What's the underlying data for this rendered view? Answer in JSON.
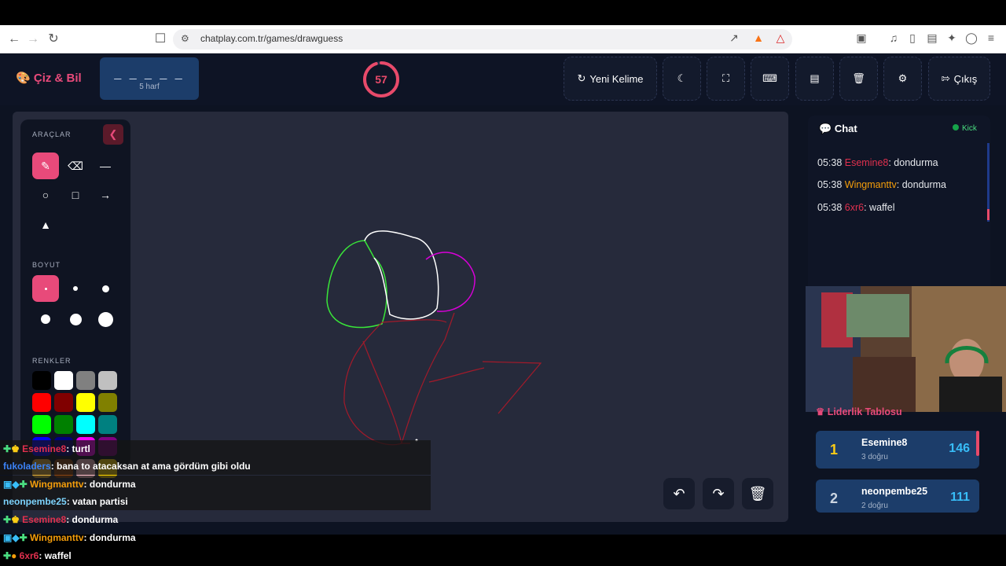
{
  "browser": {
    "url": "chatplay.com.tr/games/drawguess"
  },
  "header": {
    "logo": "Çiz & Bil",
    "word_dashes": "_ _ _ _ _",
    "word_hint": "5 harf",
    "timer": "57",
    "timer_progress": 0.95,
    "new_word_label": "Yeni Kelime",
    "exit_label": "Çıkış"
  },
  "tools": {
    "section_tools": "ARAÇLAR",
    "section_size": "BOYUT",
    "section_colors": "RENKLER",
    "colors": [
      "#000000",
      "#ffffff",
      "#808080",
      "#c0c0c0",
      "#ff0000",
      "#800000",
      "#ffff00",
      "#808000",
      "#00ff00",
      "#008000",
      "#00ffff",
      "#008080",
      "#0000ff",
      "#000080",
      "#ff00ff",
      "#800080",
      "#e2b03c",
      "#8b4513",
      "#ffc0cb",
      "#ffd700"
    ]
  },
  "chat": {
    "title": "Chat",
    "platform": "Kick",
    "messages": [
      {
        "time": "05:38",
        "user": "Esemine8",
        "text": ": dondurma",
        "color": "#e0304e"
      },
      {
        "time": "05:38",
        "user": "Wingmanttv",
        "text": ": dondurma",
        "color": "#f59e0b"
      },
      {
        "time": "05:38",
        "user": "6xr6",
        "text": ": waffel",
        "color": "#e0304e"
      }
    ]
  },
  "leaderboard": {
    "title": "Liderlik Tablosu",
    "rows": [
      {
        "rank": "1",
        "name": "Esemine8",
        "sub": "3 doğru",
        "score": "146",
        "rank_color": "#facc15"
      },
      {
        "rank": "2",
        "name": "neonpembe25",
        "sub": "2 doğru",
        "score": "111",
        "rank_color": "#cbd5e1"
      }
    ]
  },
  "overlay_chat": [
    {
      "user": "Esemine8",
      "text": ": turtl",
      "color": "#e0304e"
    },
    {
      "user": "fukoladers",
      "text": ": bana to atacaksan at ama gördüm gibi oldu",
      "color": "#3b82f6"
    },
    {
      "user": "Wingmanttv",
      "text": ": dondurma",
      "color": "#f59e0b"
    },
    {
      "user": "neonpembe25",
      "text": ": vatan partisi",
      "color": "#7dd3fc"
    },
    {
      "user": "Esemine8",
      "text": ": dondurma",
      "color": "#e0304e"
    },
    {
      "user": "Wingmanttv",
      "text": ": dondurma",
      "color": "#f59e0b"
    },
    {
      "user": "6xr6",
      "text": ": waffel",
      "color": "#e0304e"
    }
  ]
}
